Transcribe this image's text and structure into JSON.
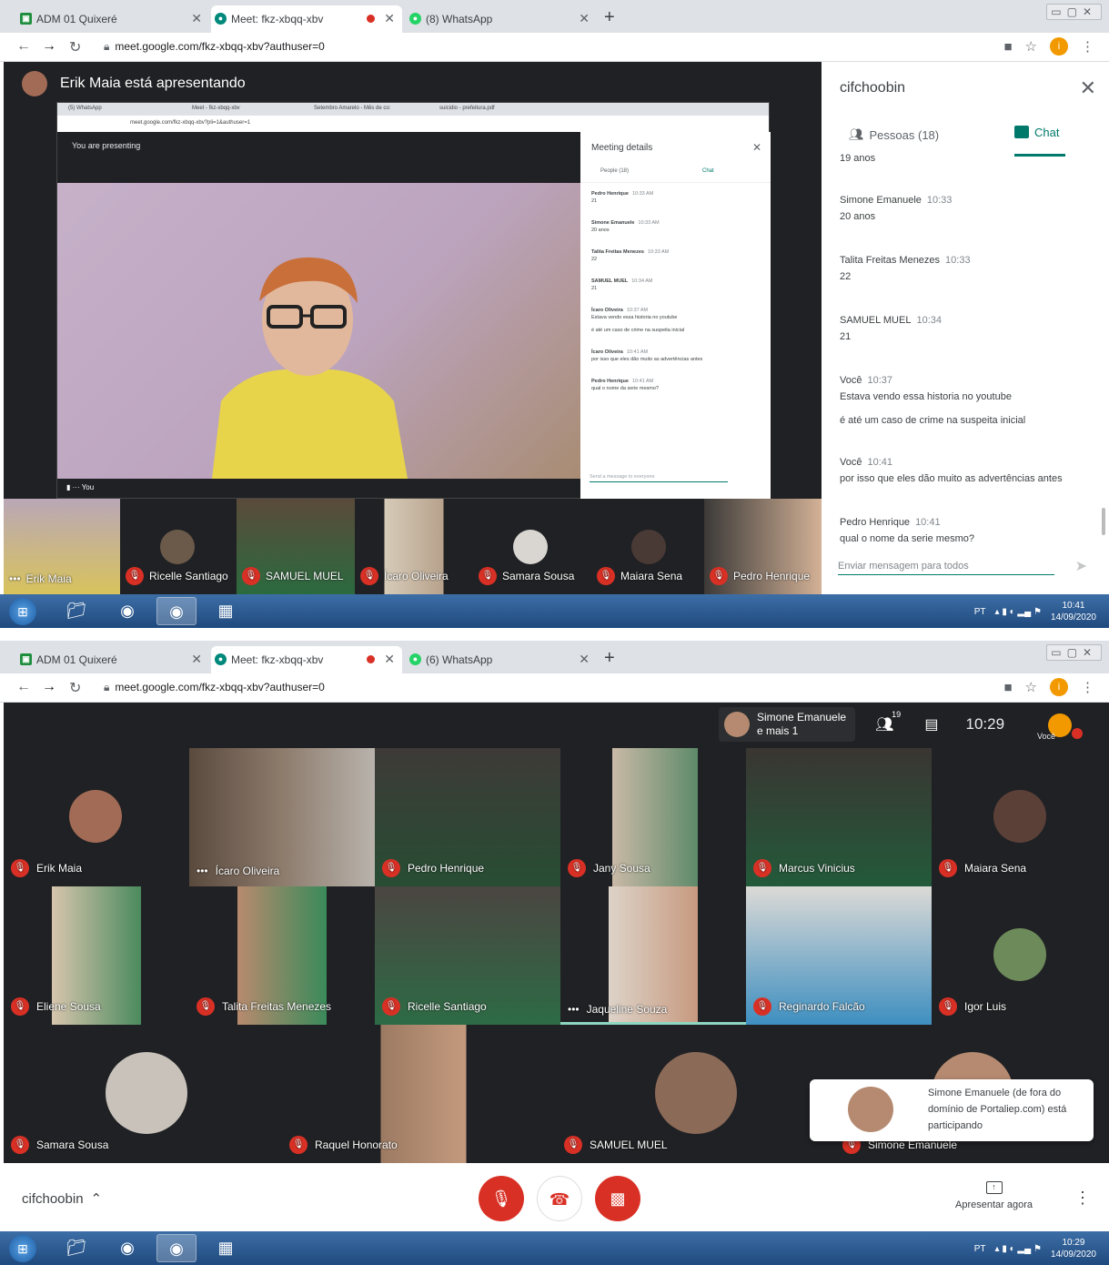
{
  "browser": {
    "tabs": [
      {
        "label": "ADM 01 Quixeré",
        "icon": "classroom-icon",
        "color": "#1e8e3e"
      },
      {
        "label": "Meet: fkz-xbqq-xbv",
        "icon": "meet-icon",
        "color": "#00897b",
        "active": true
      },
      {
        "label": "(8) WhatsApp",
        "icon": "whatsapp-icon",
        "color": "#25d366"
      }
    ],
    "tabs_shot2": [
      {
        "label": "ADM 01 Quixeré"
      },
      {
        "label": "Meet: fkz-xbqq-xbv"
      },
      {
        "label": "(6) WhatsApp"
      }
    ],
    "url": "meet.google.com/fkz-xbqq-xbv?authuser=0"
  },
  "shot1": {
    "presenting_label": "Erik Maia está apresentando",
    "inner": {
      "tabs": [
        "(5) WhatsApp",
        "Meet - fkz-xbqq-xbv",
        "Setembro Amarelo - Mês de co:",
        "suicidio - prefeitura.pdf"
      ],
      "url": "meet.google.com/fkz-xbqq-xbv?pli=1&authuser=1",
      "you_presenting": "You are presenting",
      "you_label": "You",
      "panel_title": "Meeting details",
      "people_tab": "People (18)",
      "chat_tab": "Chat",
      "messages": [
        {
          "name": "Pedro Henrique",
          "time": "10:33 AM",
          "lines": [
            "21"
          ]
        },
        {
          "name": "Simone Emanuele",
          "time": "10:33 AM",
          "lines": [
            "20 anos"
          ]
        },
        {
          "name": "Talita Freitas Menezes",
          "time": "10:33 AM",
          "lines": [
            "22"
          ]
        },
        {
          "name": "SAMUEL MUEL",
          "time": "10:34 AM",
          "lines": [
            "21"
          ]
        },
        {
          "name": "Ícaro Oliveira",
          "time": "10:37 AM",
          "lines": [
            "Estava vendo essa historia no youtube",
            "é até um caso de crime na suspeita inicial"
          ]
        },
        {
          "name": "Ícaro Oliveira",
          "time": "10:41 AM",
          "lines": [
            "por isso que eles dão muito as advertências antes"
          ]
        },
        {
          "name": "Pedro Henrique",
          "time": "10:41 AM",
          "lines": [
            "qual o nome da serie mesmo?"
          ]
        }
      ],
      "input_placeholder": "Send a message to everyone"
    },
    "strip": [
      {
        "name": "Erik Maia",
        "muted": false
      },
      {
        "name": "Ricelle Santiago",
        "muted": true
      },
      {
        "name": "SAMUEL MUEL",
        "muted": true
      },
      {
        "name": "Ícaro Oliveira",
        "muted": true
      },
      {
        "name": "Samara Sousa",
        "muted": true
      },
      {
        "name": "Maiara Sena",
        "muted": true
      },
      {
        "name": "Pedro Henrique",
        "muted": true
      }
    ],
    "panel": {
      "title": "cifchoobin",
      "people_tab": "Pessoas (18)",
      "chat_tab": "Chat",
      "first_partial": "19 anos",
      "messages": [
        {
          "name": "Simone Emanuele",
          "time": "10:33",
          "lines": [
            "20 anos"
          ]
        },
        {
          "name": "Talita Freitas Menezes",
          "time": "10:33",
          "lines": [
            "22"
          ]
        },
        {
          "name": "SAMUEL MUEL",
          "time": "10:34",
          "lines": [
            "21"
          ]
        },
        {
          "name": "Você",
          "time": "10:37",
          "lines": [
            "Estava vendo essa historia no youtube",
            "é até um caso de crime na suspeita inicial"
          ]
        },
        {
          "name": "Você",
          "time": "10:41",
          "lines": [
            "por isso que eles dão muito as advertências antes"
          ]
        },
        {
          "name": "Pedro Henrique",
          "time": "10:41",
          "lines": [
            "qual o nome da serie mesmo?"
          ]
        }
      ],
      "input_placeholder": "Enviar mensagem para todos"
    },
    "taskbar": {
      "lang": "PT",
      "time": "10:41",
      "date": "14/09/2020"
    }
  },
  "shot2": {
    "presenting_chip": [
      "Simone Emanuele",
      "e mais 1"
    ],
    "people_count": "19",
    "time": "10:29",
    "you_label": "Você",
    "tiles": [
      {
        "name": "Erik Maia",
        "muted": true
      },
      {
        "name": "Ícaro Oliveira",
        "muted": false
      },
      {
        "name": "Pedro Henrique",
        "muted": true
      },
      {
        "name": "Jany Sousa",
        "muted": true
      },
      {
        "name": "Marcus Vinicius",
        "muted": true
      },
      {
        "name": "Maiara Sena",
        "muted": true
      },
      {
        "name": "Eliene Sousa",
        "muted": true
      },
      {
        "name": "Talita Freitas Menezes",
        "muted": true
      },
      {
        "name": "Ricelle Santiago",
        "muted": true
      },
      {
        "name": "Jaqueline Souza",
        "muted": false
      },
      {
        "name": "Reginardo Falcão",
        "muted": true
      },
      {
        "name": "Igor Luis",
        "muted": true
      },
      {
        "name": "Samara Sousa",
        "muted": true
      },
      {
        "name": "Raquel Honorato",
        "muted": true
      },
      {
        "name": "SAMUEL MUEL",
        "muted": true
      },
      {
        "name": "Simone Emanuele",
        "muted": true
      }
    ],
    "toast": "Simone Emanuele (de fora do domínio de Portaliep.com) está participando",
    "meeting_name": "cifchoobin",
    "present_label": "Apresentar agora",
    "taskbar": {
      "lang": "PT",
      "time": "10:29",
      "date": "14/09/2020"
    }
  }
}
